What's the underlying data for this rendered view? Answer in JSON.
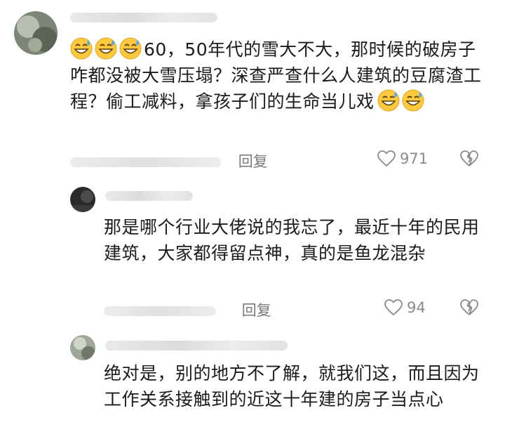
{
  "comments": [
    {
      "text": "60，50年代的雪大不大，那时候的破房子咋都没被大雪压塌？深查严查什么人建筑的豆腐渣工程？偷工减料，拿孩子们的生命当儿戏",
      "reply_label": "回复",
      "likes": "971"
    },
    {
      "text": "那是哪个行业大佬说的我忘了，最近十年的民用建筑，大家都得留点神，真的是鱼龙混杂",
      "reply_label": "回复",
      "likes": "94"
    },
    {
      "text": "绝对是，别的地方不了解，就我们这，而且因为工作关系接触到的近这十年建的房子当点心"
    }
  ],
  "icons": {
    "emoji": "grinning-sweat-emoji",
    "like": "heart-outline-icon",
    "dislike": "broken-heart-icon"
  },
  "colors": {
    "emoji_face": "#ffc83d",
    "emoji_sweat": "#5aa9e6",
    "meta_gray": "#8a8a8a"
  }
}
